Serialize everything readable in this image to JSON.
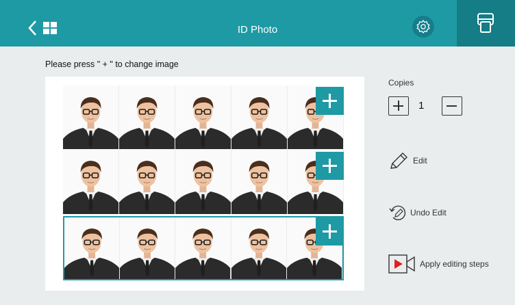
{
  "header": {
    "title": "ID Photo",
    "accent_color": "#1e9aa4",
    "icons": [
      "back-icon",
      "grid-icon",
      "settings-icon",
      "print-icon"
    ]
  },
  "instruction": "Please press \" + \"  to change image",
  "sheet": {
    "rows": 3,
    "columns": 5,
    "selected_row": 3,
    "add_label": "+"
  },
  "copies": {
    "label": "Copies",
    "value": "1"
  },
  "actions": {
    "edit": "Edit",
    "undo": "Undo Edit",
    "apply": "Apply editing steps"
  }
}
